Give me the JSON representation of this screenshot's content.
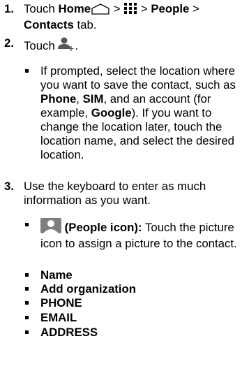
{
  "steps": [
    {
      "number": "1.",
      "text": {
        "touch": "Touch ",
        "home": "Home",
        "sep1": " > ",
        "sep2": " > ",
        "people": "People",
        "sep3": " >",
        "contacts": "Contacts",
        "tab": " tab."
      }
    },
    {
      "number": "2.",
      "text": {
        "touch": "Touch ",
        "end": "."
      },
      "bullet": {
        "a": "If prompted, select the location where you want to save the contact, such as ",
        "phone": "Phone",
        "comma1": ", ",
        "sim": "SIM",
        "b": ", and an account (for example, ",
        "google": "Google",
        "c": "). If you want to change the location later, touch the location name, and select the desired location."
      }
    },
    {
      "number": "3.",
      "text": "Use the keyboard to enter as much information as you want.",
      "bullets": {
        "people_label": " (People icon):",
        "people_desc": " Touch the picture icon to assign a picture to the contact.",
        "name": "Name",
        "organization": "Add organization",
        "phone": "PHONE",
        "email": "EMAIL",
        "address": "ADDRESS"
      }
    }
  ],
  "icons": [
    "home-icon",
    "apps-grid-icon",
    "add-contact-icon",
    "people-picture-icon"
  ]
}
